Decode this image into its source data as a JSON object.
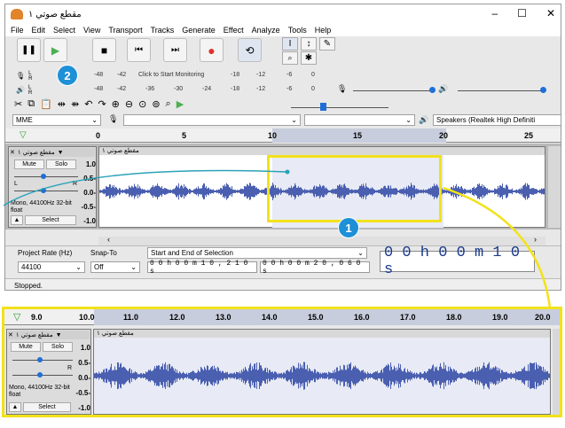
{
  "window": {
    "title": "مقطع صوتي ١",
    "minimize": "–",
    "maximize": "☐",
    "close": "✕"
  },
  "menu": [
    "File",
    "Edit",
    "Select",
    "View",
    "Transport",
    "Tracks",
    "Generate",
    "Effect",
    "Analyze",
    "Tools",
    "Help"
  ],
  "transport": {
    "pause": "❚❚",
    "play": "▶",
    "stop": "■",
    "skip_start": "⏮",
    "skip_end": "⏭",
    "record": "●",
    "loop": "⟲"
  },
  "tools": {
    "selection": "I",
    "envelope": "↕",
    "draw": "✎",
    "zoom": "🔍",
    "multi": "✱"
  },
  "meters": {
    "record_monitor_text": "Click to Start Monitoring",
    "record_scale": [
      "-48",
      "-42",
      "",
      "-18",
      "-12",
      "-6",
      "0"
    ],
    "play_scale": [
      "-48",
      "-42",
      "-36",
      "-30",
      "-24",
      "-18",
      "-12",
      "-6",
      "0"
    ],
    "lr": [
      "L",
      "R"
    ]
  },
  "devices": {
    "host": "MME",
    "output": "Speakers (Realtek High Definiti"
  },
  "ruler_top": {
    "ticks": [
      "0",
      "5",
      "10",
      "15",
      "20",
      "25"
    ]
  },
  "track": {
    "name": "مقطع صوتي ١",
    "clip_name": "مقطع صوتي ١",
    "close": "✕",
    "menu_arrow": "▼",
    "mute": "Mute",
    "solo": "Solo",
    "left": "L",
    "right": "R",
    "info": "Mono, 44100Hz 32-bit float",
    "collapse": "▲",
    "select": "Select",
    "yaxis": [
      "1.0",
      "0.5-",
      "0.0-",
      "-0.5-",
      "-1.0"
    ]
  },
  "selection_bar": {
    "project_rate_label": "Project Rate (Hz)",
    "snap_to_label": "Snap-To",
    "project_rate": "44100",
    "snap_to": "Off",
    "selection_mode": "Start and End of Selection",
    "start": "0 0 h 0 0 m 1 0 , 2 1 0 s",
    "end": "0 0 h 0 0 m 2 0 , 0 6 0 s",
    "position": "0 0 h 0 0 m 1 0 s"
  },
  "status": "Stopped.",
  "zoom_ruler": {
    "ticks": [
      "9.0",
      "10.0",
      "11.0",
      "12.0",
      "13.0",
      "14.0",
      "15.0",
      "16.0",
      "17.0",
      "18.0",
      "19.0",
      "20.0"
    ]
  },
  "badges": {
    "one": "1",
    "two": "2"
  },
  "colors": {
    "waveform": "#4a5fb0",
    "highlight": "#f2e21b",
    "badge": "#1e90d7",
    "selected_bg": "#e8ebf5"
  }
}
